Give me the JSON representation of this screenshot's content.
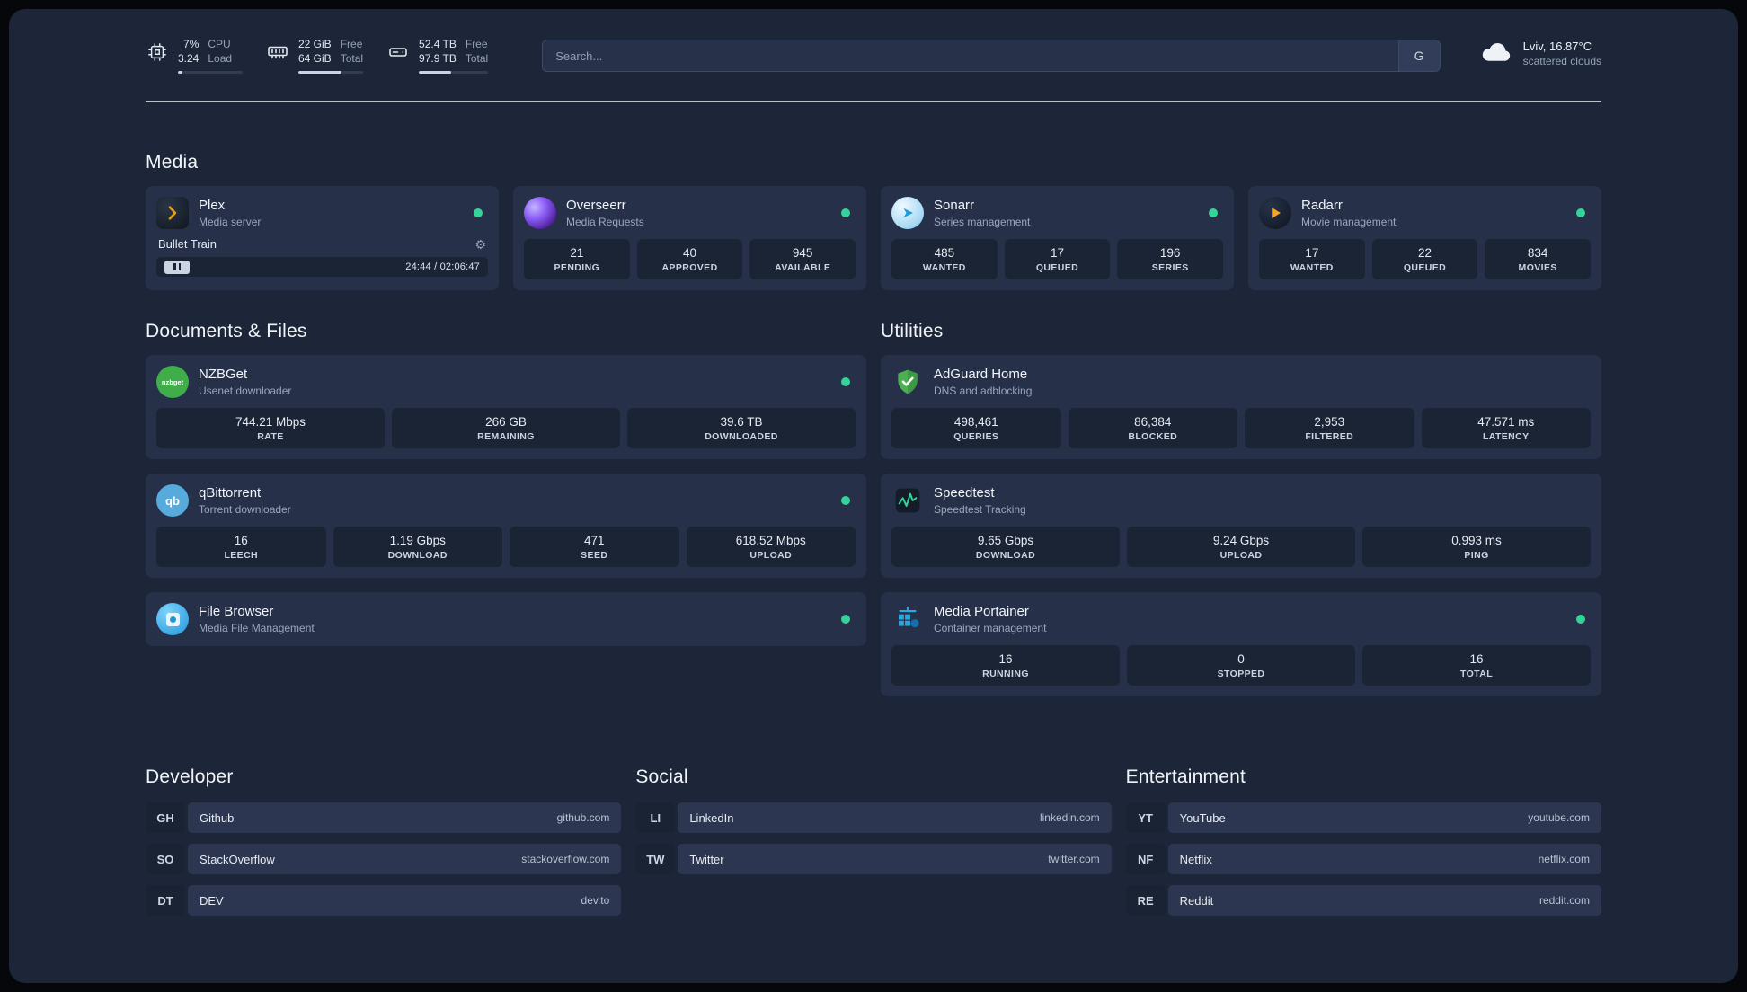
{
  "colors": {
    "panel_bg": "#1c2638",
    "card_bg": "#263049",
    "stat_bg": "#1b2434",
    "status_green": "#34d399",
    "plex_amber": "#e5a00d",
    "radarr_amber": "#f5a623",
    "sonarr_blue": "#1b9ddb",
    "adguard_green": "#4caf50",
    "portainer_blue": "#29a8e0"
  },
  "header": {
    "cpu": {
      "value1": "7%",
      "value2": "3.24",
      "label1": "CPU",
      "label2": "Load",
      "used_percent": 7
    },
    "ram": {
      "value1": "22 GiB",
      "value2": "64 GiB",
      "label1": "Free",
      "label2": "Total",
      "used_percent": 66
    },
    "disk": {
      "value1": "52.4 TB",
      "value2": "97.9 TB",
      "label1": "Free",
      "label2": "Total",
      "used_percent": 47
    },
    "search_placeholder": "Search...",
    "search_button": "G",
    "weather_location": "Lviv, 16.87°C",
    "weather_condition": "scattered clouds"
  },
  "media": {
    "title": "Media",
    "plex": {
      "name": "Plex",
      "desc": "Media server",
      "now_playing": "Bullet Train",
      "time": "24:44 / 02:06:47"
    },
    "overseerr": {
      "name": "Overseerr",
      "desc": "Media Requests",
      "stats": [
        {
          "value": "21",
          "label": "PENDING"
        },
        {
          "value": "40",
          "label": "APPROVED"
        },
        {
          "value": "945",
          "label": "AVAILABLE"
        }
      ]
    },
    "sonarr": {
      "name": "Sonarr",
      "desc": "Series management",
      "stats": [
        {
          "value": "485",
          "label": "WANTED"
        },
        {
          "value": "17",
          "label": "QUEUED"
        },
        {
          "value": "196",
          "label": "SERIES"
        }
      ]
    },
    "radarr": {
      "name": "Radarr",
      "desc": "Movie management",
      "stats": [
        {
          "value": "17",
          "label": "WANTED"
        },
        {
          "value": "22",
          "label": "QUEUED"
        },
        {
          "value": "834",
          "label": "MOVIES"
        }
      ]
    }
  },
  "documents": {
    "title": "Documents & Files",
    "nzbget": {
      "name": "NZBGet",
      "desc": "Usenet downloader",
      "logo_text": "nzbget",
      "stats": [
        {
          "value": "744.21 Mbps",
          "label": "RATE"
        },
        {
          "value": "266 GB",
          "label": "REMAINING"
        },
        {
          "value": "39.6 TB",
          "label": "DOWNLOADED"
        }
      ]
    },
    "qbittorrent": {
      "name": "qBittorrent",
      "desc": "Torrent downloader",
      "logo_text": "qb",
      "stats": [
        {
          "value": "16",
          "label": "LEECH"
        },
        {
          "value": "1.19 Gbps",
          "label": "DOWNLOAD"
        },
        {
          "value": "471",
          "label": "SEED"
        },
        {
          "value": "618.52 Mbps",
          "label": "UPLOAD"
        }
      ]
    },
    "filebrowser": {
      "name": "File Browser",
      "desc": "Media File Management"
    }
  },
  "utilities": {
    "title": "Utilities",
    "adguard": {
      "name": "AdGuard Home",
      "desc": "DNS and adblocking",
      "stats": [
        {
          "value": "498,461",
          "label": "QUERIES"
        },
        {
          "value": "86,384",
          "label": "BLOCKED"
        },
        {
          "value": "2,953",
          "label": "FILTERED"
        },
        {
          "value": "47.571 ms",
          "label": "LATENCY"
        }
      ]
    },
    "speedtest": {
      "name": "Speedtest",
      "desc": "Speedtest Tracking",
      "stats": [
        {
          "value": "9.65 Gbps",
          "label": "DOWNLOAD"
        },
        {
          "value": "9.24 Gbps",
          "label": "UPLOAD"
        },
        {
          "value": "0.993 ms",
          "label": "PING"
        }
      ]
    },
    "portainer": {
      "name": "Media Portainer",
      "desc": "Container management",
      "stats": [
        {
          "value": "16",
          "label": "RUNNING"
        },
        {
          "value": "0",
          "label": "STOPPED"
        },
        {
          "value": "16",
          "label": "TOTAL"
        }
      ]
    }
  },
  "bookmarks": {
    "developer": {
      "title": "Developer",
      "items": [
        {
          "abbr": "GH",
          "name": "Github",
          "url": "github.com"
        },
        {
          "abbr": "SO",
          "name": "StackOverflow",
          "url": "stackoverflow.com"
        },
        {
          "abbr": "DT",
          "name": "DEV",
          "url": "dev.to"
        }
      ]
    },
    "social": {
      "title": "Social",
      "items": [
        {
          "abbr": "LI",
          "name": "LinkedIn",
          "url": "linkedin.com"
        },
        {
          "abbr": "TW",
          "name": "Twitter",
          "url": "twitter.com"
        }
      ]
    },
    "entertainment": {
      "title": "Entertainment",
      "items": [
        {
          "abbr": "YT",
          "name": "YouTube",
          "url": "youtube.com"
        },
        {
          "abbr": "NF",
          "name": "Netflix",
          "url": "netflix.com"
        },
        {
          "abbr": "RE",
          "name": "Reddit",
          "url": "reddit.com"
        }
      ]
    }
  }
}
